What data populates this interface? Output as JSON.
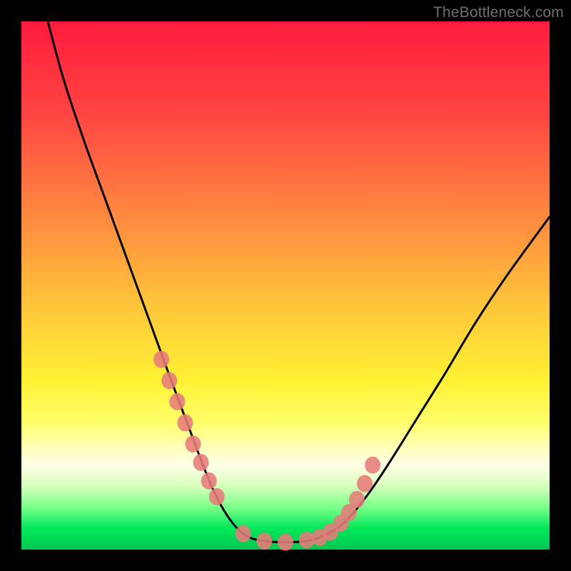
{
  "watermark": "TheBottleneck.com",
  "chart_data": {
    "type": "line",
    "title": "",
    "xlabel": "",
    "ylabel": "",
    "xlim": [
      0,
      100
    ],
    "ylim": [
      0,
      100
    ],
    "series": [
      {
        "name": "curve",
        "type": "line",
        "x": [
          5,
          8,
          12,
          16,
          20,
          24,
          28,
          31,
          34,
          36,
          38,
          40,
          42,
          44,
          47,
          50,
          53,
          56,
          59,
          62,
          66,
          70,
          75,
          80,
          86,
          92,
          100
        ],
        "y": [
          100,
          89,
          77,
          66,
          55,
          44,
          33,
          25,
          17,
          12,
          8,
          5,
          3,
          2,
          1.5,
          1.4,
          1.5,
          2.1,
          3.5,
          6,
          11,
          17,
          25,
          33,
          43,
          52,
          63
        ]
      },
      {
        "name": "markers",
        "type": "scatter",
        "x": [
          26.5,
          28,
          29.5,
          31,
          32.5,
          34,
          35.5,
          37,
          42,
          46,
          50,
          54,
          56.5,
          58.5,
          60.5,
          62,
          63.5,
          65,
          66.5
        ],
        "y": [
          36,
          32,
          28,
          24,
          20,
          16.5,
          13,
          10,
          3,
          1.6,
          1.4,
          1.8,
          2.3,
          3.3,
          5,
          7,
          9.5,
          12.5,
          16
        ]
      }
    ],
    "gradient_bands": [
      "#ff1a3e",
      "#ff4642",
      "#ff9a3e",
      "#fff133",
      "#ffff6a",
      "#ffffe6",
      "#7aff8a",
      "#00c84e"
    ]
  }
}
